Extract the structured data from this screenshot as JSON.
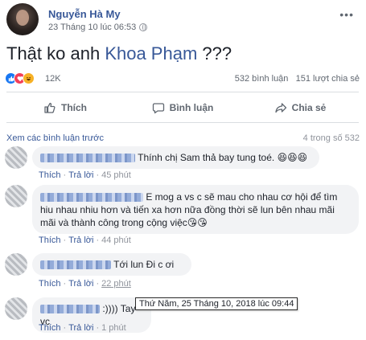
{
  "post": {
    "author": "Nguyễn Hà My",
    "time": "23 Tháng 10 lúc 06:53",
    "text_before": "Thật ko anh ",
    "mention": "Khoa Phạm",
    "text_after": " ???"
  },
  "reactions": {
    "icons": [
      "like-icon",
      "love-icon",
      "haha-icon"
    ],
    "count": "12K",
    "comments": "532 bình luận",
    "shares": "151 lượt chia sẻ"
  },
  "actions": {
    "like": "Thích",
    "comment": "Bình luận",
    "share": "Chia sẻ"
  },
  "comments_section": {
    "view_previous": "Xem các bình luận trước",
    "count": "4 trong số 532",
    "items": [
      {
        "text": "Thính chị Sam thả bay tung toé. 😆😆😆",
        "like": "Thích",
        "reply": "Trả lời",
        "time": "45 phút"
      },
      {
        "text": "E mog a vs c sẽ mau cho nhau cơ hội để tìm hiu nhau nhiu hơn và tiến xa hơn nữa đồng thời sẽ lun bên nhau mãi mãi và thành công trong cộng việc😘😘",
        "like": "Thích",
        "reply": "Trả lời",
        "time": "44 phút"
      },
      {
        "text": "Tới lun Đi c ơi",
        "like": "Thích",
        "reply": "Trả lời",
        "time": "22 phút"
      },
      {
        "text": ":)))) Tay vc",
        "like": "Thích",
        "reply": "Trả lời",
        "time": "1 phút"
      }
    ]
  },
  "tooltip": "Thứ Năm, 25 Tháng 10, 2018 lúc 09:44",
  "colors": {
    "link": "#385898",
    "muted": "#90949c",
    "bubble": "#f2f3f5",
    "like": "#1877f2",
    "love": "#f33e58",
    "haha": "#f7b125"
  }
}
